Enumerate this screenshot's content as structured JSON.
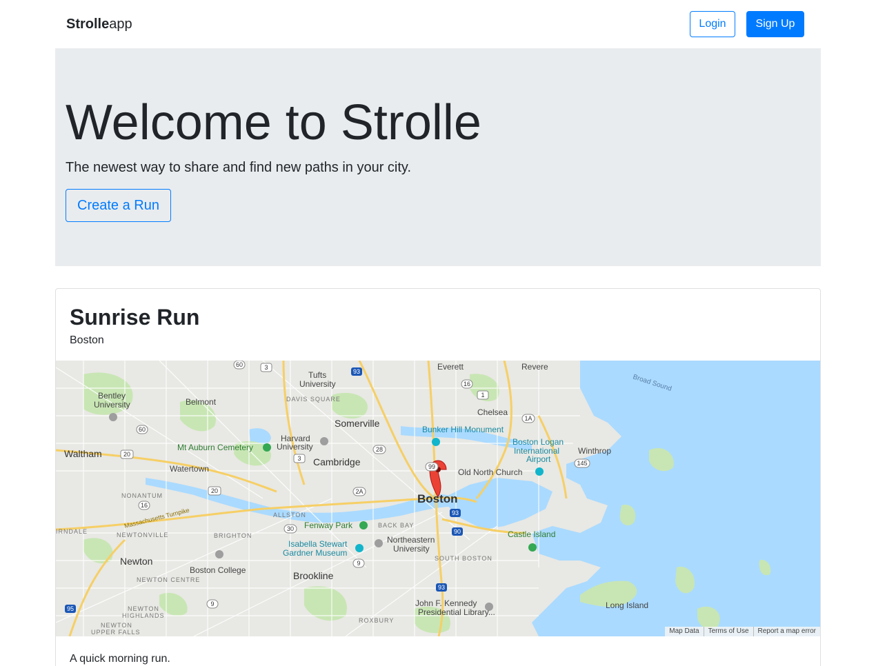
{
  "navbar": {
    "brand_bold": "Strolle",
    "brand_light": "app",
    "login_label": "Login",
    "signup_label": "Sign Up"
  },
  "hero": {
    "title": "Welcome to Strolle",
    "lead": "The newest way to share and find new paths in your city.",
    "create_label": "Create a Run"
  },
  "run": {
    "title": "Sunrise Run",
    "city": "Boston",
    "description": "A quick morning run."
  },
  "map": {
    "labels": {
      "everett": "Everett",
      "revere": "Revere",
      "tufts": "Tufts",
      "tufts2": "University",
      "bentley": "Bentley",
      "bentley2": "University",
      "belmont": "Belmont",
      "davis": "DAVIS SQUARE",
      "somerville": "Somerville",
      "chelsea": "Chelsea",
      "broad_sound": "Broad Sound",
      "bunker": "Bunker Hill Monument",
      "harvard": "Harvard",
      "harvard2": "University",
      "auburn": "Mt Auburn Cemetery",
      "waltham": "Waltham",
      "cambridge": "Cambridge",
      "logan": "Boston Logan",
      "logan2": "International",
      "logan3": "Airport",
      "winthrop": "Winthrop",
      "watertown": "Watertown",
      "oldnorth": "Old North Church",
      "boston": "Boston",
      "nonantum": "NONANTUM",
      "masspike": "Massachusetts Turnpike",
      "allston": "ALLSTON",
      "fenway": "Fenway Park",
      "backbay": "BACK BAY",
      "newtonville": "NEWTONVILLE",
      "brighton": "BRIGHTON",
      "irndale": "IRNDALE",
      "stewart": "Isabella Stewart",
      "stewart2": "Gardner Museum",
      "northeastern": "Northeastern",
      "northeastern2": "University",
      "castle": "Castle Island",
      "southboston": "SOUTH BOSTON",
      "newton": "Newton",
      "bc": "Boston College",
      "brookline": "Brookline",
      "newtoncentre": "NEWTON CENTRE",
      "jfk": "John F. Kennedy",
      "jfk2": "Presidential Library...",
      "newtonhighlands": "NEWTON",
      "newtonhighlands2": "HIGHLANDS",
      "newtonupper": "NEWTON",
      "newtonupper2": "UPPER FALLS",
      "roxbury": "ROXBURY",
      "longisland": "Long Island"
    },
    "shields": {
      "r60a": "60",
      "r3a": "3",
      "i93a": "93",
      "r16a": "16",
      "r1a": "1",
      "r1A": "1A",
      "r60b": "60",
      "r20a": "20",
      "r3b": "3",
      "r28": "28",
      "r99": "99",
      "r145": "145",
      "r20b": "20",
      "r2A": "2A",
      "r16b": "16",
      "i93b": "93",
      "r30": "30",
      "i90": "90",
      "r9a": "9",
      "i93c": "93",
      "i95": "95",
      "r9b": "9"
    },
    "footer": {
      "data": "Map Data",
      "terms": "Terms of Use",
      "report": "Report a map error"
    },
    "colors": {
      "water": "#aadaff",
      "land": "#e8e8e4",
      "park": "#c8e6b4",
      "highway": "#f6cf65",
      "road": "#ffffff",
      "pin": "#ea4335"
    }
  }
}
